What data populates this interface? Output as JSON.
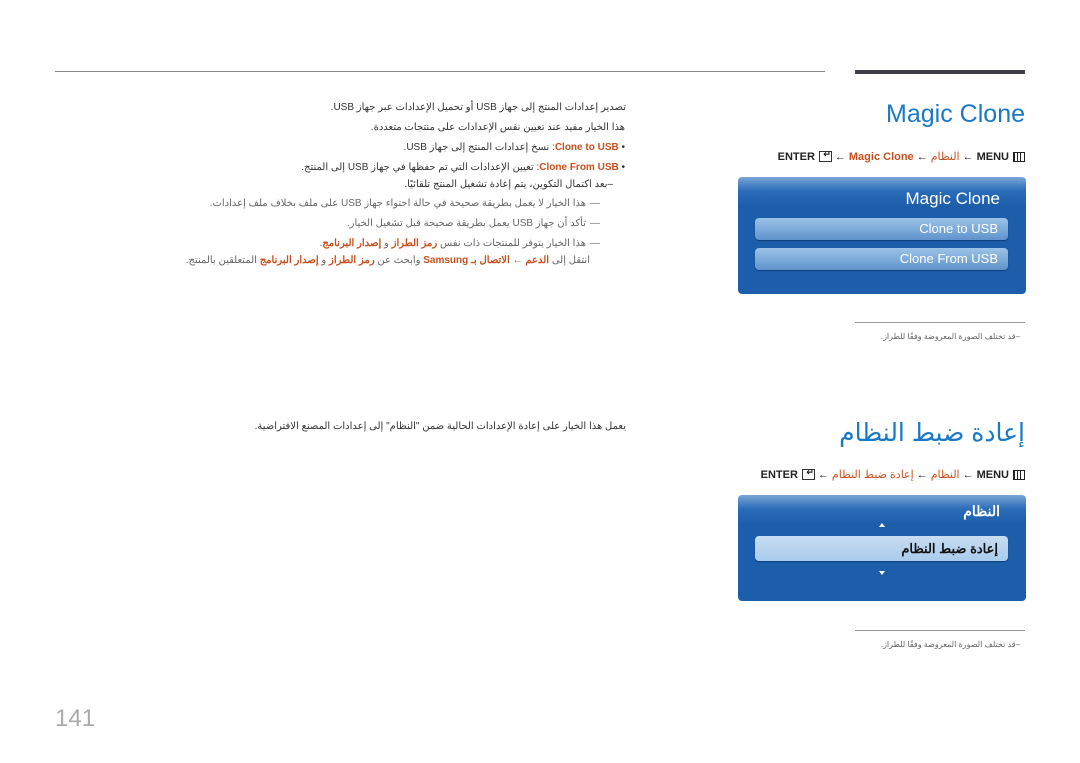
{
  "page_number": "141",
  "section1": {
    "title": "Magic Clone",
    "breadcrumb": {
      "menu": "MENU",
      "step1": "النظام",
      "step2": "Magic Clone",
      "enter": "ENTER",
      "arrow": "←"
    },
    "panel": {
      "title": "Magic Clone",
      "buttons": [
        "Clone to USB",
        "Clone From USB"
      ]
    },
    "image_note": "–قد تختلف الصورة المعروضة وفقًا للطراز.",
    "body": {
      "intro1": "تصدير إعدادات المنتج إلى جهاز USB أو تحميل الإعدادات عبر جهاز USB.",
      "intro2": "هذا الخيار مفيد عند تعيين نفس الإعدادات على منتجات متعددة.",
      "bullet1_term": "Clone to USB",
      "bullet1_text": ": نسخ إعدادات المنتج إلى جهاز USB.",
      "bullet2_term": "Clone From USB",
      "bullet2_text": ": تعيين الإعدادات التي تم حفظها في جهاز USB إلى المنتج.",
      "bullet2_sub": "–بعد اكتمال التكوين، يتم إعادة تشغيل المنتج تلقائيًا.",
      "note1": "هذا الخيار لا يعمل بطريقة صحيحة في حالة احتواء جهاز USB على ملف بخلاف ملف إعدادات.",
      "note2": "تأكد أن جهاز USB يعمل بطريقة صحيحة قبل تشغيل الخيار.",
      "note3_a": "هذا الخيار يتوفر للمنتجات ذات نفس ",
      "note3_b": "رمز الطراز",
      "note3_c": " و ",
      "note3_d": "إصدار البرنامج",
      "note3_e": ".",
      "note4_a": "انتقل إلى ",
      "note4_b": "الدعم",
      "note4_c": " ← ",
      "note4_d": "الاتصال بـ Samsung",
      "note4_e": " وابحث عن ",
      "note4_f": "رمز الطراز",
      "note4_g": " و ",
      "note4_h": "إصدار البرنامج",
      "note4_i": " المتعلقين بالمنتج."
    }
  },
  "section2": {
    "title": "إعادة ضبط النظام",
    "breadcrumb": {
      "menu": "MENU",
      "step1": "النظام",
      "step2": "إعادة ضبط النظام",
      "enter": "ENTER",
      "arrow": "←"
    },
    "panel": {
      "title": "النظام",
      "selected": "إعادة ضبط النظام"
    },
    "image_note": "–قد تختلف الصورة المعروضة وفقًا للطراز.",
    "body": "يعمل هذا الخيار على إعادة الإعدادات الحالية ضمن \"النظام\" إلى إعدادات المصنع الافتراضية."
  }
}
